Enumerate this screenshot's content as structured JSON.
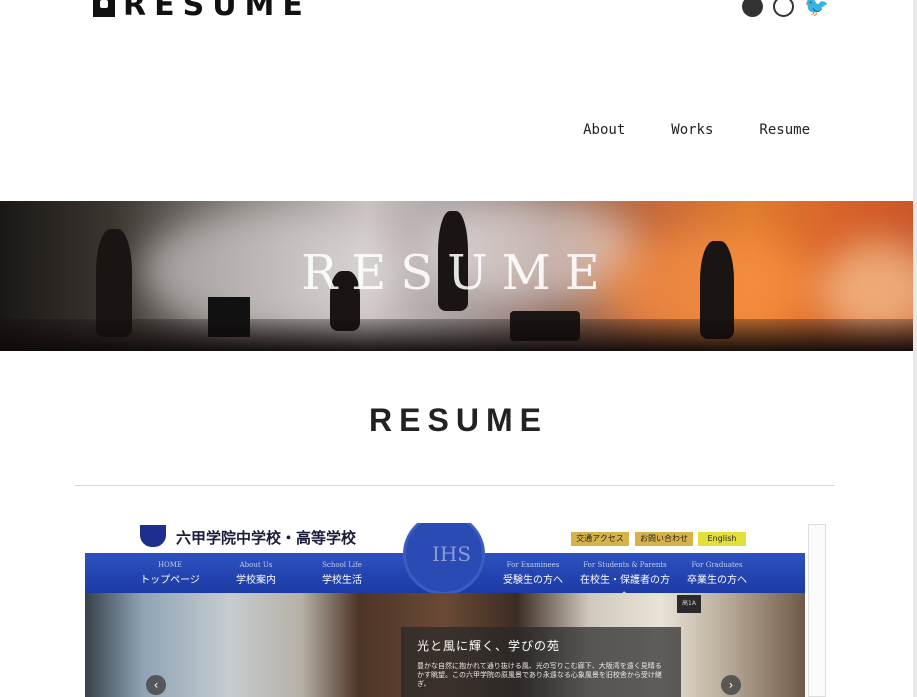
{
  "header": {
    "logo_text": "RESUME",
    "social_icons": [
      "github-icon",
      "search-icon",
      "twitter-icon"
    ]
  },
  "nav": {
    "items": [
      "About",
      "Works",
      "Resume"
    ]
  },
  "hero": {
    "title": "RESUME"
  },
  "page": {
    "title": "RESUME"
  },
  "work_screenshot": {
    "school_name": "六甲学院中学校・高等学校",
    "seal_text": "IHS",
    "utility_links": [
      "交通アクセス",
      "お問い合わせ",
      "English"
    ],
    "menu": [
      {
        "en": "HOME",
        "jp": "トップページ"
      },
      {
        "en": "About Us",
        "jp": "学校案内"
      },
      {
        "en": "School Life",
        "jp": "学校生活"
      },
      {
        "en": "For Examinees",
        "jp": "受験生の方へ"
      },
      {
        "en": "For Students & Parents",
        "jp": "在校生・保護者の方へ"
      },
      {
        "en": "For Graduates",
        "jp": "卒業生の方へ"
      }
    ],
    "badge": "高1A",
    "caption_heading": "光と風に輝く、学びの苑",
    "caption_body": "豊かな自然に抱かれて通り抜ける風、光の写りこむ廊下、大阪湾を遠く見晴るかす眺望。この六甲学院の原風景であり永遠なる心象風景を旧校舎から受け継ぎ、"
  },
  "colors": {
    "accent_blue": "#1c3aa4",
    "text": "#222222"
  }
}
